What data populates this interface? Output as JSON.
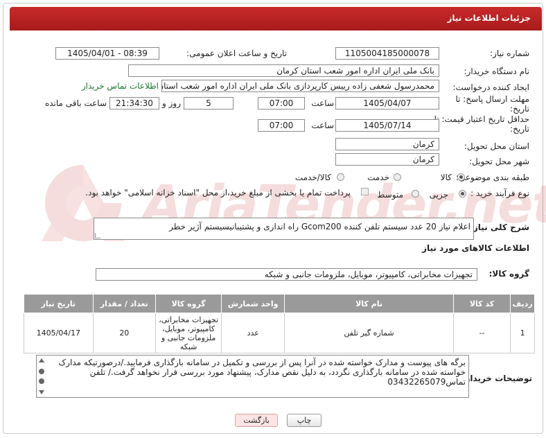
{
  "header": {
    "title": "جزئیات اطلاعات نیاز"
  },
  "form": {
    "need_number_label": "شماره نیاز:",
    "need_number": "1105004185000078",
    "announce_label": "تاریخ و ساعت اعلان عمومی:",
    "announce_value": "1405/04/01 - 08:39",
    "buyer_label": "نام دستگاه خریدار:",
    "buyer_value": "بانک ملی ایران اداره امور شعب استان کرمان",
    "creator_label": "ایجاد کننده درخواست:",
    "creator_value": "محمدرسول شعفی زاده رییس کارپردازی بانک ملی ایران اداره امور شعب استان",
    "contact_link": "اطلاعات تماس خریدار",
    "deadline_label": "مهلت ارسال پاسخ: تا تاریخ:",
    "deadline_date": "1405/04/07",
    "hour_label": "ساعت",
    "deadline_hour": "07:00",
    "days_value": "5",
    "days_label": "روز و",
    "remaining_time": "21:34:30",
    "remaining_label": "ساعت باقی مانده",
    "validity_label": "حداقل تاریخ اعتبار قیمت: تا تاریخ:",
    "validity_date": "1405/07/14",
    "validity_hour": "07:00",
    "province_label": "استان محل تحویل:",
    "province_value": "کرمان",
    "city_label": "شهر محل تحویل:",
    "city_value": "کرمان",
    "category_label": "طبقه بندی موضوعی:",
    "category_options": [
      "کالا",
      "خدمت",
      "کالا/خدمت"
    ],
    "process_label": "نوع فرآیند خرید :",
    "process_options": [
      "جزیی",
      "متوسط"
    ],
    "payment_note": "پرداخت تمام یا بخشی از مبلغ خرید،از محل \"اسناد خزانه اسلامی\" خواهد بود.",
    "summary_label": "شرح کلی نیاز:",
    "summary_value": "اعلام نیاز 20 عدد سیستم تلفن کننده Gcom200 راه اندازی و پشتیبانیسیستم آژیر خطر",
    "goods_info_title": "اطلاعات کالاهای مورد نیاز",
    "goods_group_label": "گروه کالا:",
    "goods_group_value": "تجهیزات مخابراتی، کامپیوتر، موبایل، ملزومات جانبی و شبکه",
    "buyer_notes_label": "توضیحات خریدار:",
    "buyer_notes": "برگه های پیوست و مدارک خواسته شده در آنرا پس از بررسی و تکمیل در سامانه بارگذاری فرمایید./درصورتیکه مدارک خواسته شده در سامانه بارگذاری نگردد، به دلیل نقص مدارک، پیشنهاد مورد بررسی قرار نخواهد گرفت./ تلفن تماس03432265079"
  },
  "table": {
    "headers": [
      "ردیف",
      "کد کالا",
      "نام کالا",
      "واحد شمارش",
      "گروه کالا",
      "تعداد / مقدار",
      "تاریخ نیاز"
    ],
    "rows": [
      [
        "1",
        "--",
        "شماره گیر تلفن",
        "عدد",
        "تجهیزات مخابراتی، کامپیوتر، موبایل، ملزومات جانبی و شبکه",
        "20",
        "1405/04/17"
      ]
    ]
  },
  "buttons": {
    "print": "چاپ",
    "back": "بازگشت"
  },
  "watermark": "AriaTender.net",
  "colors": {
    "title_bar": "#b52222",
    "link": "#1a7a2e",
    "table_header": "#9a9a9a"
  }
}
